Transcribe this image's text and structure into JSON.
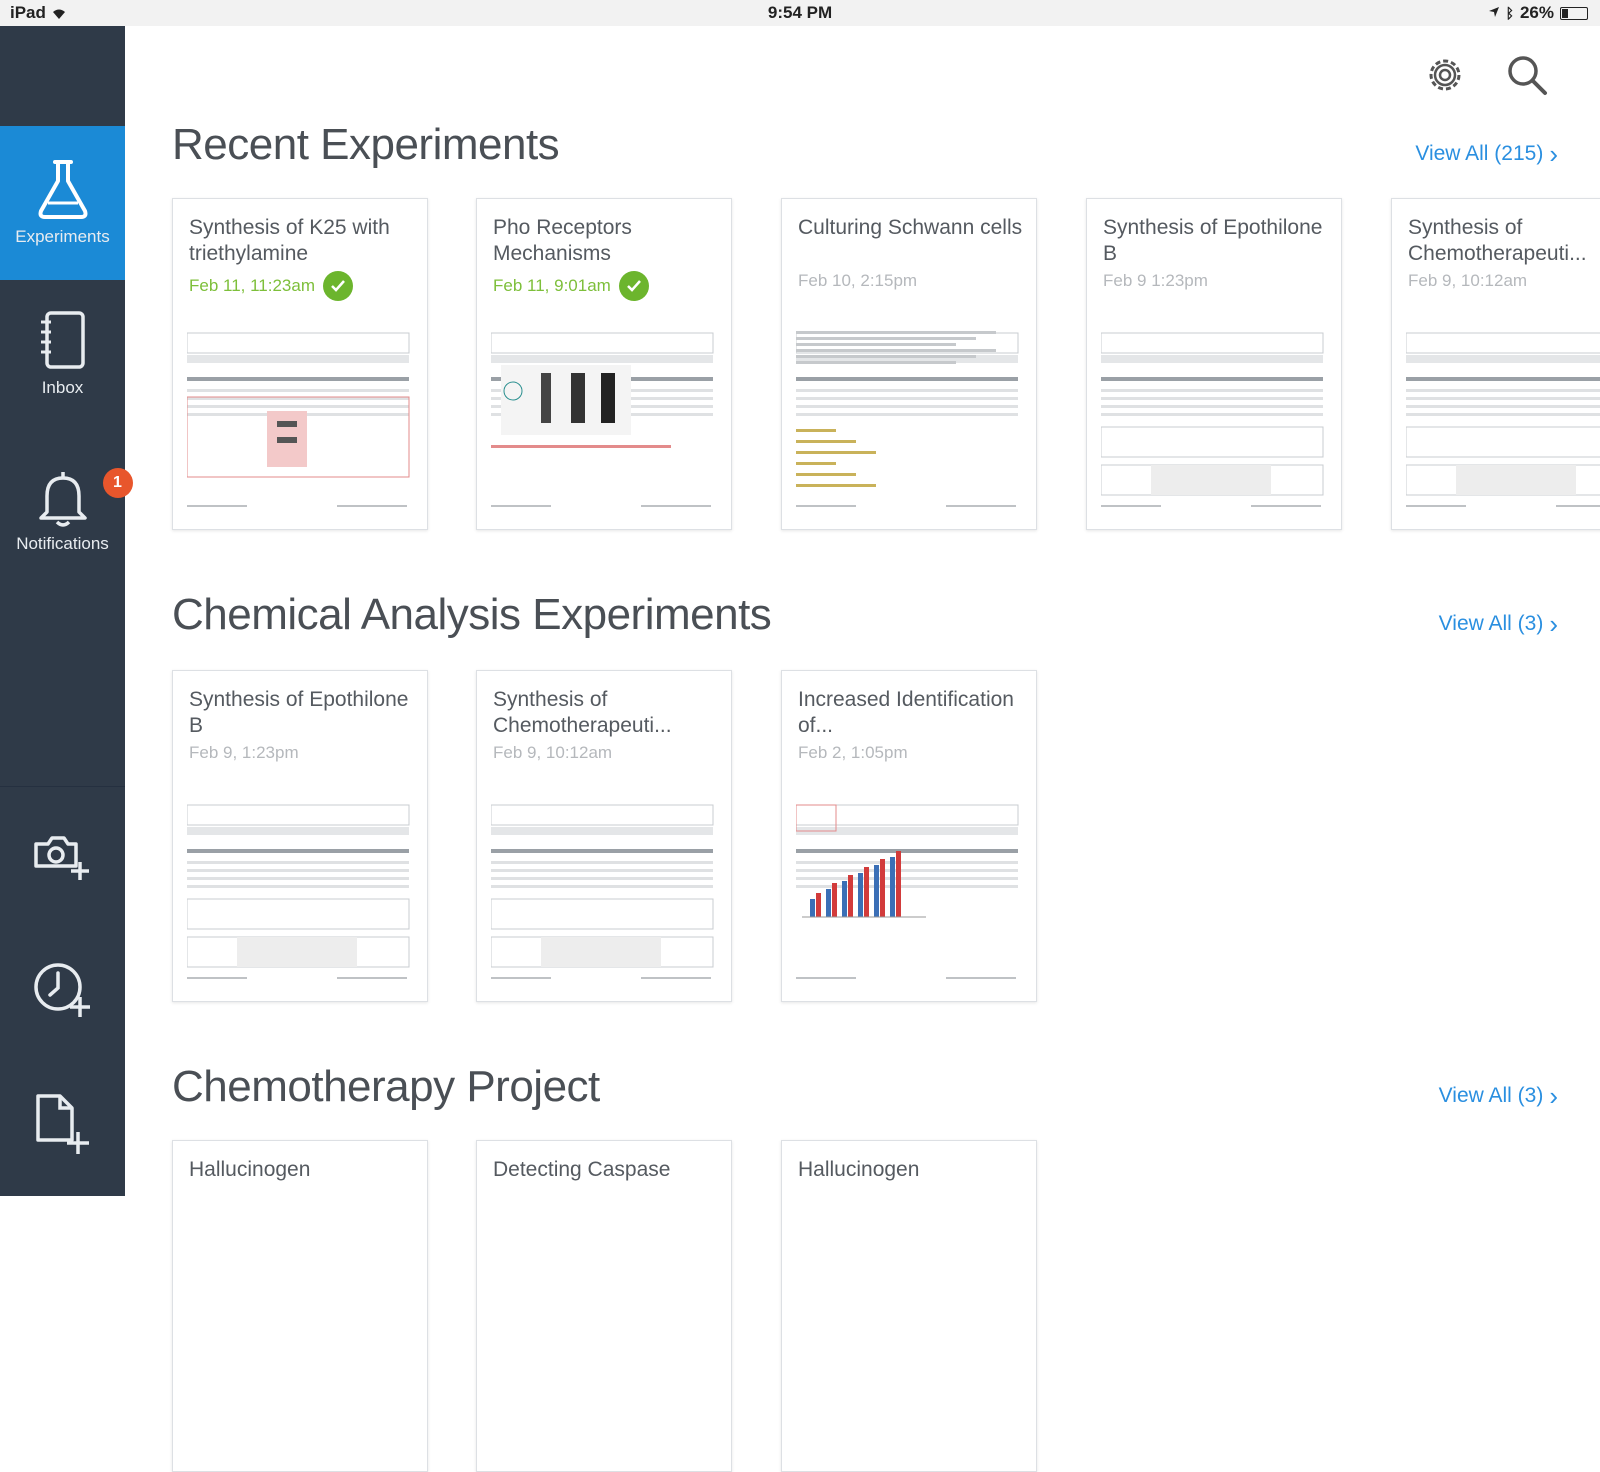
{
  "status_bar": {
    "device": "iPad",
    "time": "9:54 PM",
    "battery": "26%",
    "battery_level": 0.26
  },
  "sidebar": {
    "nav": [
      {
        "label": "Experiments",
        "icon": "flask-icon",
        "active": true
      },
      {
        "label": "Inbox",
        "icon": "notebook-icon",
        "active": false
      },
      {
        "label": "Notifications",
        "icon": "bell-icon",
        "active": false,
        "badge": "1"
      }
    ],
    "actions": [
      {
        "icon": "camera-add-icon"
      },
      {
        "icon": "clock-add-icon"
      },
      {
        "icon": "document-add-icon"
      }
    ]
  },
  "header": {
    "settings_icon": "gear-icon",
    "search_icon": "search-icon"
  },
  "sections": [
    {
      "title": "Recent Experiments",
      "view_all": "View All (215)",
      "cards": [
        {
          "title": "Synthesis of K25 with triethylamine",
          "date": "Feb 11, 11:23am",
          "signed": true
        },
        {
          "title": "Pho Receptors Mechanisms",
          "date": "Feb 11, 9:01am",
          "signed": true
        },
        {
          "title": "Culturing Schwann cells",
          "date": "Feb 10, 2:15pm",
          "signed": false
        },
        {
          "title": "Synthesis of Epothilone B",
          "date": "Feb 9 1:23pm",
          "signed": false
        },
        {
          "title": "Synthesis of Chemotherapeuti...",
          "date": "Feb 9, 10:12am",
          "signed": false
        }
      ]
    },
    {
      "title": "Chemical Analysis Experiments",
      "view_all": "View All (3)",
      "cards": [
        {
          "title": "Synthesis of Epothilone B",
          "date": "Feb 9, 1:23pm",
          "signed": false
        },
        {
          "title": "Synthesis of Chemotherapeuti...",
          "date": "Feb 9, 10:12am",
          "signed": false
        },
        {
          "title": "Increased Identification of...",
          "date": "Feb 2, 1:05pm",
          "signed": false
        }
      ]
    },
    {
      "title": "Chemotherapy Project",
      "view_all": "View All (3)",
      "cards": [
        {
          "title": "Hallucinogen",
          "date": "",
          "signed": false
        },
        {
          "title": "Detecting Caspase",
          "date": "",
          "signed": false
        },
        {
          "title": "Hallucinogen",
          "date": "",
          "signed": false
        }
      ]
    }
  ]
}
